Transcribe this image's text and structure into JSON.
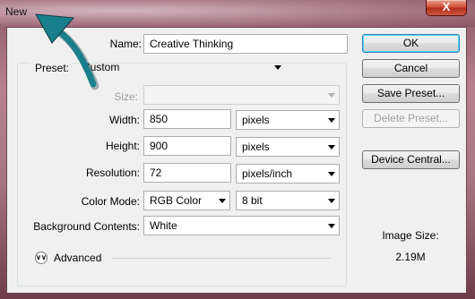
{
  "window": {
    "title": "New",
    "close_glyph": "X"
  },
  "form": {
    "name_label": "Name:",
    "name_value": "Creative Thinking",
    "preset_label": "Preset:",
    "preset_value": "Custom",
    "size_label": "Size:",
    "size_value": "",
    "width_label": "Width:",
    "width_value": "850",
    "width_unit": "pixels",
    "height_label": "Height:",
    "height_value": "900",
    "height_unit": "pixels",
    "resolution_label": "Resolution:",
    "resolution_value": "72",
    "resolution_unit": "pixels/inch",
    "color_mode_label": "Color Mode:",
    "color_mode_value": "RGB Color",
    "bit_depth_value": "8 bit",
    "background_label": "Background Contents:",
    "background_value": "White",
    "advanced_label": "Advanced"
  },
  "buttons": {
    "ok": "OK",
    "cancel": "Cancel",
    "save_preset": "Save Preset...",
    "delete_preset": "Delete Preset...",
    "device_central": "Device Central..."
  },
  "info": {
    "image_size_label": "Image Size:",
    "image_size_value": "2.19M"
  },
  "colors": {
    "annotation_arrow": "#1a7f8c",
    "default_button_border": "#3c7fb1"
  },
  "icons": {
    "advanced_toggle": "double-chevron-down-icon",
    "annotation": "curved-arrow-icon"
  }
}
